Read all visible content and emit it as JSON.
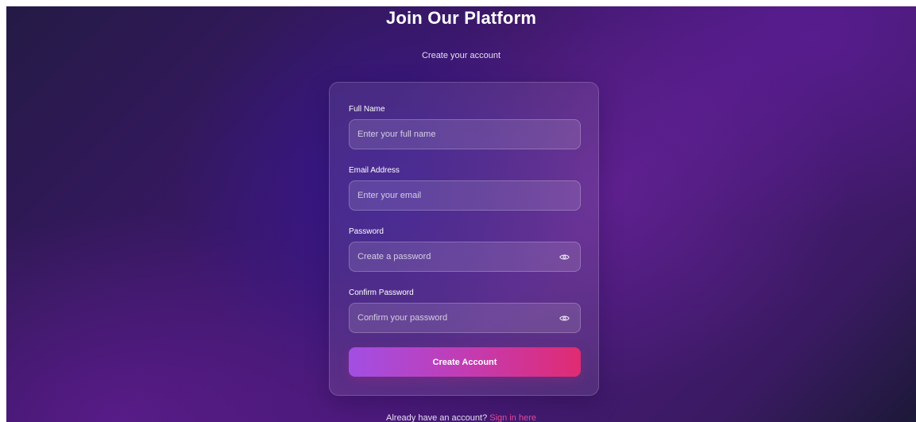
{
  "header": {
    "title": "Join Our Platform",
    "subtitle": "Create your account"
  },
  "form": {
    "full_name": {
      "label": "Full Name",
      "placeholder": "Enter your full name",
      "value": ""
    },
    "email": {
      "label": "Email Address",
      "placeholder": "Enter your email",
      "value": ""
    },
    "password": {
      "label": "Password",
      "placeholder": "Create a password",
      "value": "",
      "toggle_icon": "eye-icon"
    },
    "confirm_password": {
      "label": "Confirm Password",
      "placeholder": "Confirm your password",
      "value": "",
      "toggle_icon": "eye-icon"
    },
    "submit_label": "Create Account"
  },
  "footer": {
    "prompt": "Already have an account?",
    "link_text": "Sign in here"
  },
  "colors": {
    "button_gradient_start": "#a24fe3",
    "button_gradient_end": "#e02b72",
    "link": "#e24a9b"
  }
}
